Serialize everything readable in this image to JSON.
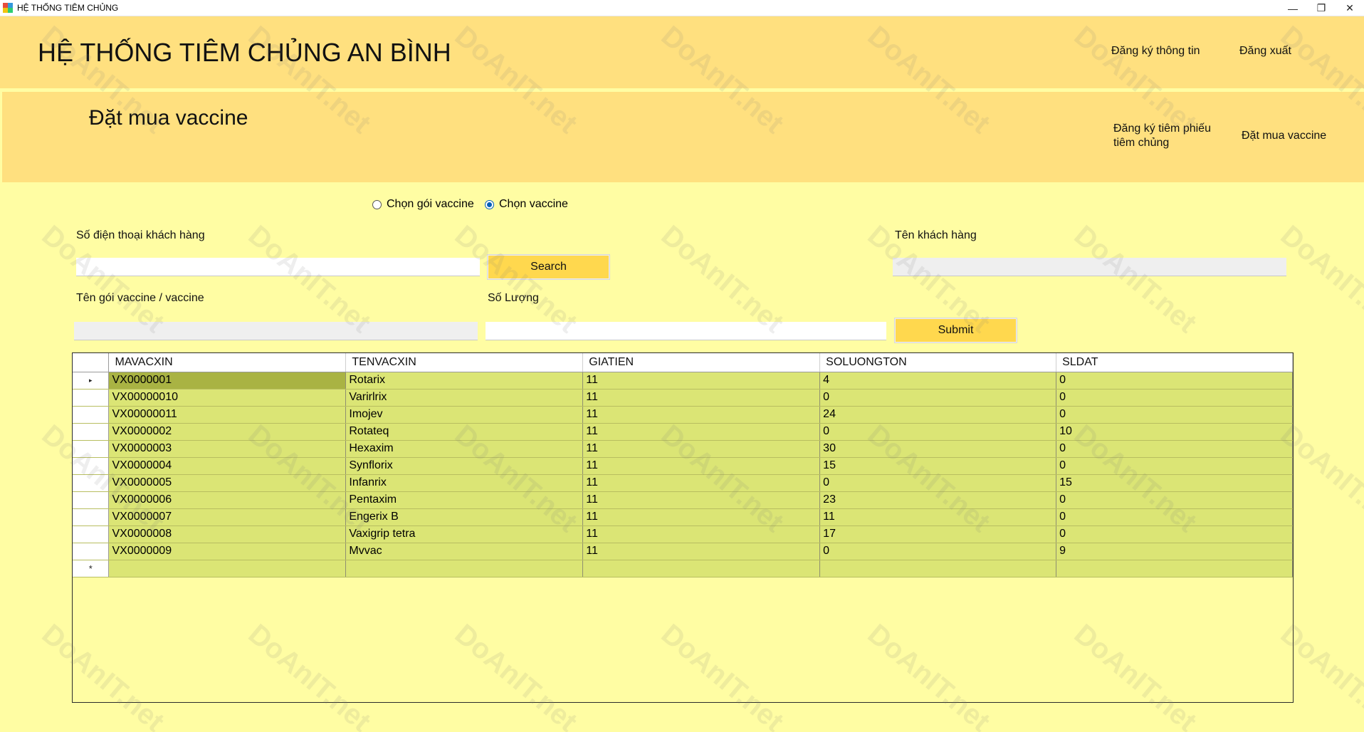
{
  "window": {
    "title": "HỆ THỐNG TIÊM CHỦNG",
    "minimize_glyph": "—",
    "restore_glyph": "❐",
    "close_glyph": "✕"
  },
  "header": {
    "system_title": "HỆ THỐNG TIÊM CHỦNG AN BÌNH",
    "register_info_link": "Đăng ký thông tin",
    "logout_link": "Đăng xuất"
  },
  "subheader": {
    "page_heading": "Đặt mua vaccine",
    "register_form_link_line1": "Đăng ký tiêm phiếu",
    "register_form_link_line2": "tiêm chủng",
    "buy_vaccine_link": "Đặt mua vaccine"
  },
  "options": {
    "package_label": "Chọn gói vaccine",
    "vaccine_label": "Chọn vaccine",
    "selected": "vaccine"
  },
  "form": {
    "phone_label": "Số điện thoại khách hàng",
    "phone_value": "",
    "search_label": "Search",
    "customer_name_label": "Tên khách hàng",
    "customer_name_value": "",
    "item_name_label": "Tên gói vaccine / vaccine",
    "item_name_value": "",
    "quantity_label": "Số Lượng",
    "quantity_value": "",
    "submit_label": "Submit"
  },
  "grid": {
    "columns": [
      "MAVACXIN",
      "TENVACXIN",
      "GIATIEN",
      "SOLUONGTON",
      "SLDAT"
    ],
    "current_row_marker": "▸",
    "new_row_marker": "*",
    "rows": [
      [
        "VX0000001",
        "Rotarix",
        "11",
        "4",
        "0"
      ],
      [
        "VX00000010",
        "Varirlrix",
        "11",
        "0",
        "0"
      ],
      [
        "VX00000011",
        "Imojev",
        "11",
        "24",
        "0"
      ],
      [
        "VX0000002",
        "Rotateq",
        "11",
        "0",
        "10"
      ],
      [
        "VX0000003",
        "Hexaxim",
        "11",
        "30",
        "0"
      ],
      [
        "VX0000004",
        "Synflorix",
        "11",
        "15",
        "0"
      ],
      [
        "VX0000005",
        "Infanrix",
        "11",
        "0",
        "15"
      ],
      [
        "VX0000006",
        "Pentaxim",
        "11",
        "23",
        "0"
      ],
      [
        "VX0000007",
        "Engerix B",
        "11",
        "11",
        "0"
      ],
      [
        "VX0000008",
        "Vaxigrip tetra",
        "11",
        "17",
        "0"
      ],
      [
        "VX0000009",
        "Mvvac",
        "11",
        "0",
        "9"
      ]
    ]
  },
  "colors": {
    "background": "#FFFDA3",
    "header": "#FFE07F",
    "button": "#FFD84E",
    "row": "#DBE575",
    "selected_cell": "#A9B343",
    "radio_accent": "#005FB8"
  },
  "watermark_text": "DoAnIT.net"
}
